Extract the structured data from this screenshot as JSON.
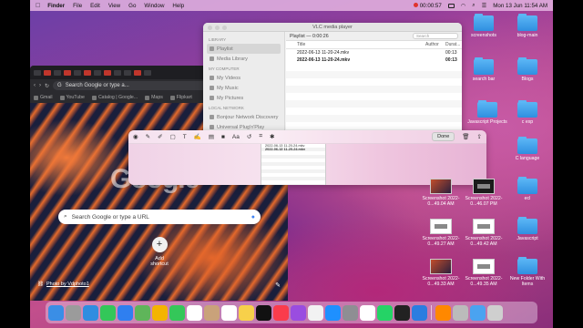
{
  "menubar": {
    "apple_icon": "apple-icon",
    "items": [
      "Finder",
      "File",
      "Edit",
      "View",
      "Go",
      "Window",
      "Help"
    ],
    "recording_time": "00:00:57",
    "datetime": "Mon 13 Jun  11:54 AM"
  },
  "chrome": {
    "omnibox_text": "Search Google or type a...",
    "bookmarks": [
      "Gmail",
      "YouTube",
      "Catalog | Google...",
      "Maps",
      "Flipkart"
    ],
    "google_logo": "Google",
    "search_placeholder": "Search Google or type a URL",
    "add_shortcut_label": "Add shortcut",
    "photo_credit": "Photo by Vdphoto1"
  },
  "vlc": {
    "title": "VLC media player",
    "sidebar": {
      "library_header": "LIBRARY",
      "library_items": [
        "Playlist",
        "Media Library"
      ],
      "computer_header": "MY COMPUTER",
      "computer_items": [
        "My Videos",
        "My Music",
        "My Pictures"
      ],
      "network_header": "LOCAL NETWORK",
      "network_items": [
        "Bonjour Network Discovery",
        "Universal Plug'n'Play"
      ]
    },
    "playlist_label": "Playlist — 0:00:26",
    "search_placeholder": "Search",
    "columns": {
      "title": "Title",
      "author": "Author",
      "duration": "Durat..."
    },
    "rows": [
      {
        "title": "2022-06-13 11-20-24.mkv",
        "author": "",
        "duration": "00:13",
        "bold": false
      },
      {
        "title": "2022-06-13 11-20-24.mkv",
        "author": "",
        "duration": "00:13",
        "bold": true
      }
    ]
  },
  "markup": {
    "done_label": "Done",
    "font_label": "Aa",
    "thumb_lines": [
      "2022-06-13 11-20-24.mkv",
      "2022-06-13 11-20-24.mkv"
    ]
  },
  "desktop_icons": [
    {
      "label": "screenshots",
      "type": "folder"
    },
    {
      "label": "blog-main",
      "type": "folder"
    },
    {
      "label": "search bar",
      "type": "folder"
    },
    {
      "label": "Blogs",
      "type": "folder"
    },
    {
      "label": "Javascript Projects",
      "type": "folder"
    },
    {
      "label": "c exp",
      "type": "folder"
    },
    {
      "label": "C language",
      "type": "folder"
    },
    {
      "label": "Screenshot 2022-0...49.04 AM",
      "type": "shot"
    },
    {
      "label": "Screenshot 2022-0...46.07 PM",
      "type": "shot"
    },
    {
      "label": "ecl",
      "type": "folder"
    },
    {
      "label": "Screenshot 2022-0...49.27 AM",
      "type": "shot"
    },
    {
      "label": "Screenshot 2022-0...49.42 AM",
      "type": "shot"
    },
    {
      "label": "Javascript",
      "type": "folder"
    },
    {
      "label": "Screenshot 2022-0...49.33 AM",
      "type": "shot"
    },
    {
      "label": "Screenshot 2022-0...49.35 AM",
      "type": "shot"
    },
    {
      "label": "New Folder With Items",
      "type": "folder"
    }
  ],
  "dock_apps": [
    "finder-icon",
    "launchpad-icon",
    "safari-icon",
    "messages-icon",
    "mail-icon",
    "maps-icon",
    "photos-icon",
    "facetime-icon",
    "calendar-icon",
    "contacts-icon",
    "reminders-icon",
    "notes-icon",
    "appletv-icon",
    "music-icon",
    "podcasts-icon",
    "news-icon",
    "appstore-icon",
    "systemprefs-icon",
    "chrome-icon",
    "whatsapp-icon",
    "terminal-icon",
    "vscode-icon",
    "vlc-icon",
    "screenshot-icon",
    "downloads-icon",
    "trash-icon"
  ]
}
